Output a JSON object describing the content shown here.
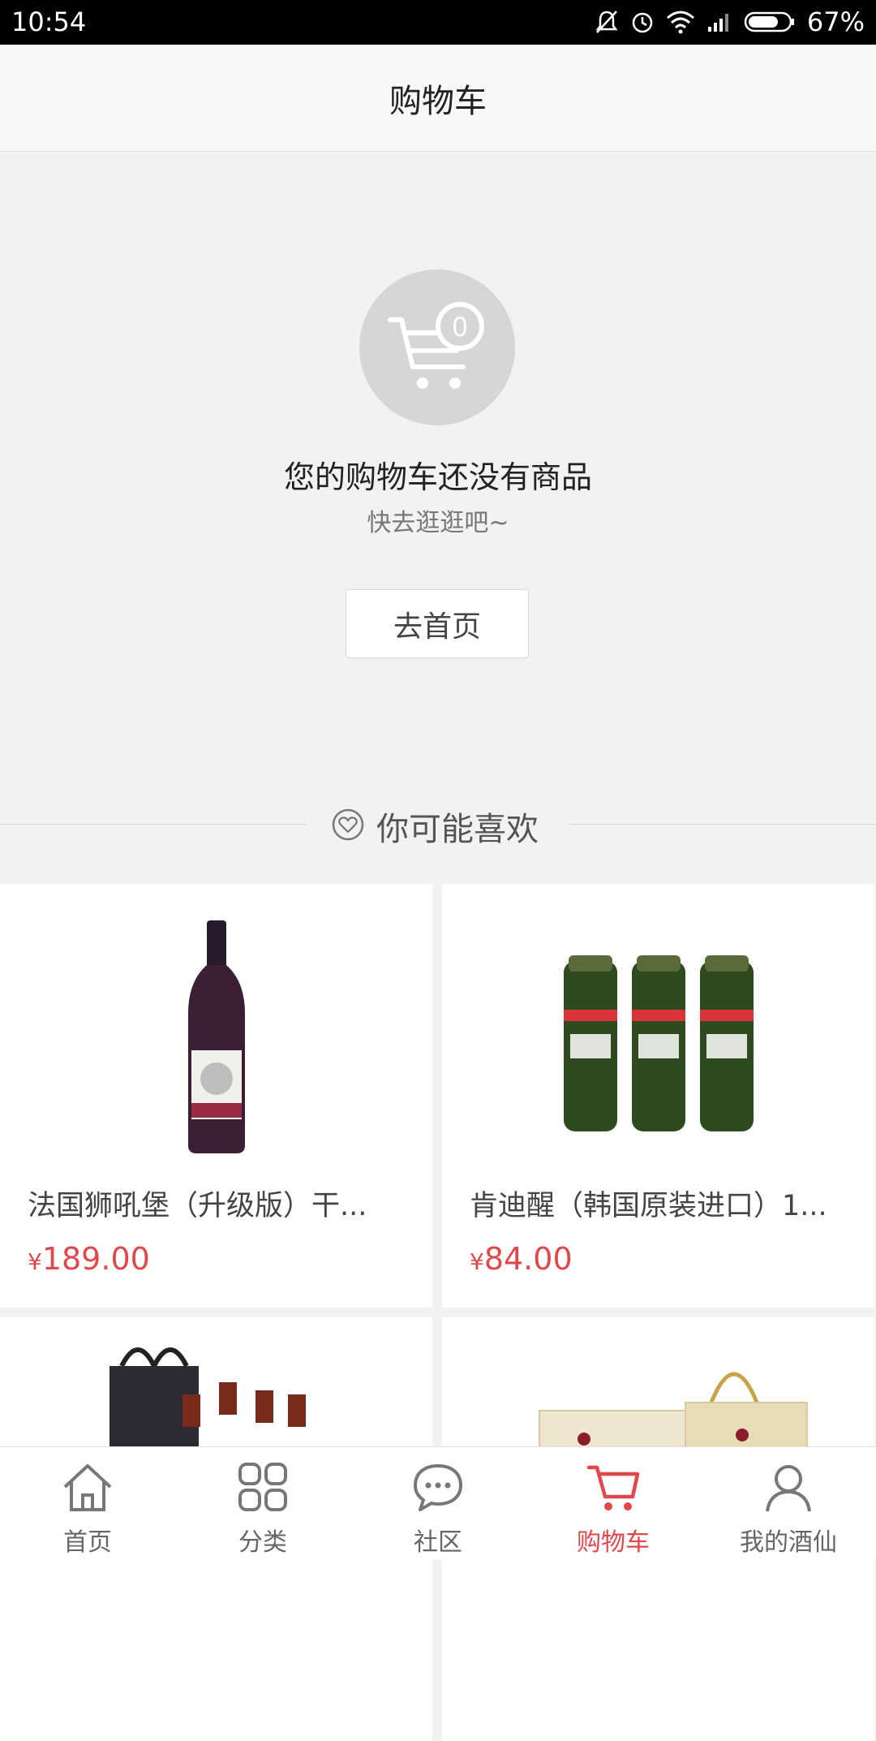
{
  "status_bar": {
    "time": "10:54",
    "battery": "67%"
  },
  "header": {
    "title": "购物车"
  },
  "empty_cart": {
    "badge_count": "0",
    "title": "您的购物车还没有商品",
    "subtitle": "快去逛逛吧~",
    "button_label": "去首页"
  },
  "recommend": {
    "label": "你可能喜欢"
  },
  "products": [
    {
      "name": "法国狮吼堡（升级版）干...",
      "currency": "¥",
      "price": "189.00"
    },
    {
      "name": "肯迪醒（韩国原装进口）1...",
      "currency": "¥",
      "price": "84.00"
    }
  ],
  "tabs": [
    {
      "label": "首页"
    },
    {
      "label": "分类"
    },
    {
      "label": "社区"
    },
    {
      "label": "购物车"
    },
    {
      "label": "我的酒仙"
    }
  ],
  "colors": {
    "accent": "#e0484c",
    "background": "#f1f2f4"
  }
}
